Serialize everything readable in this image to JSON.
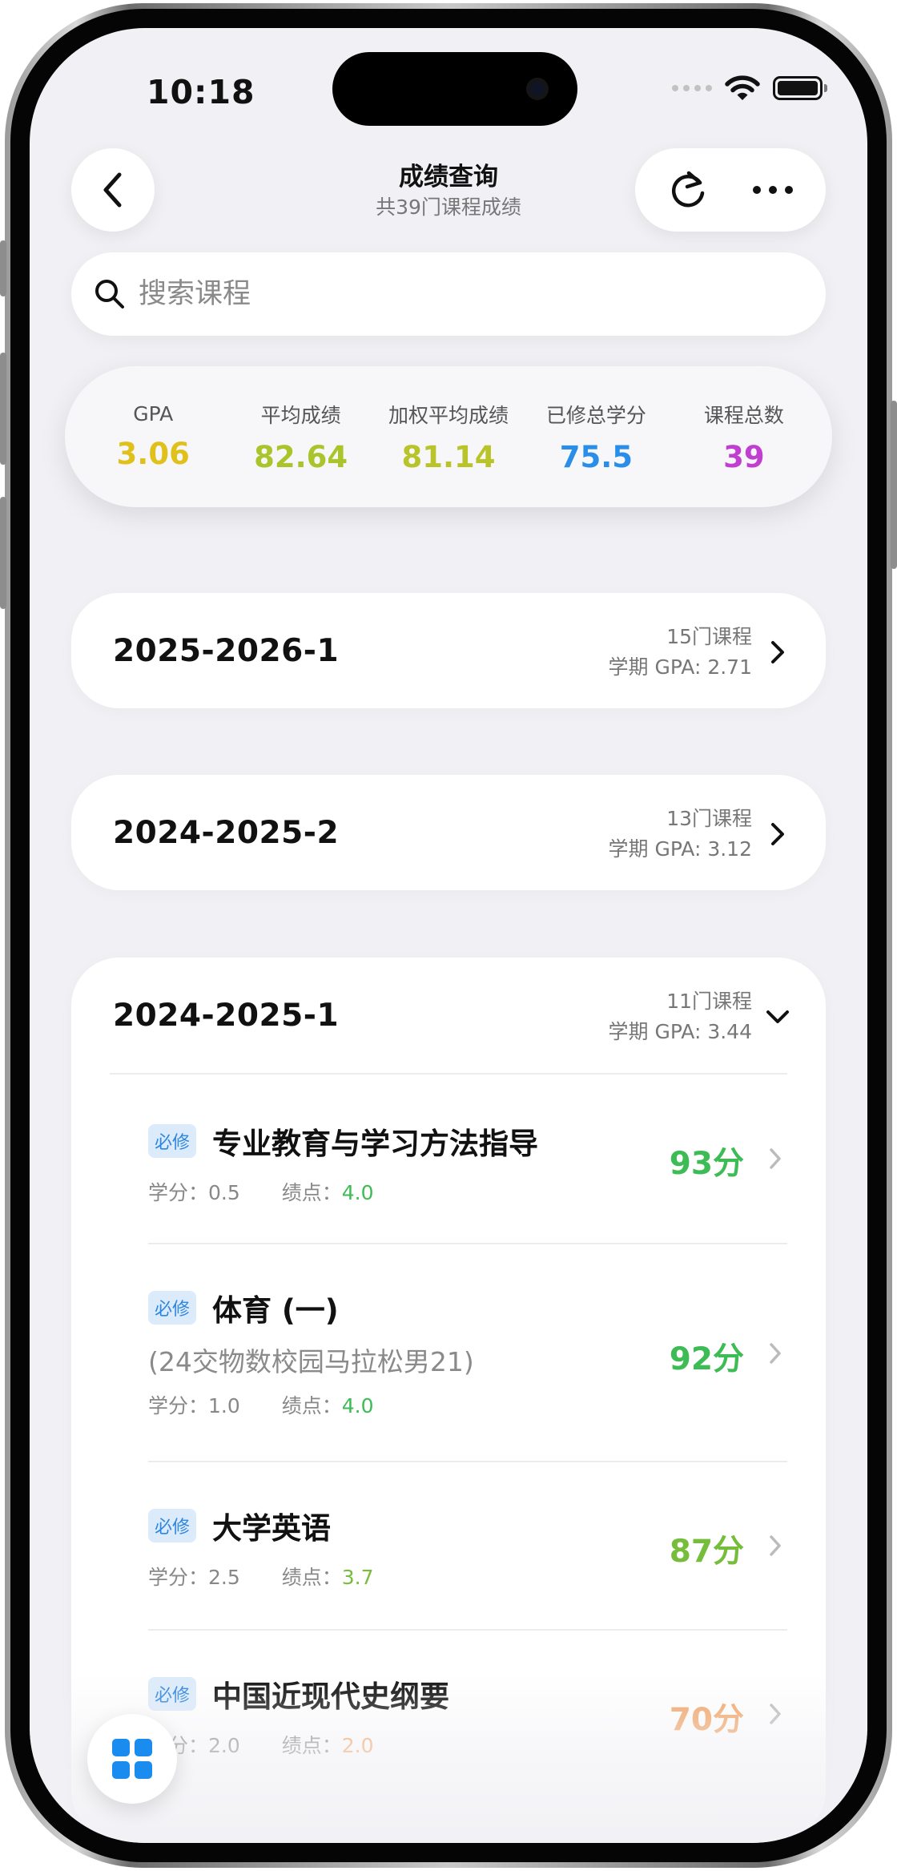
{
  "status_bar": {
    "time": "10:18"
  },
  "nav": {
    "title": "成绩查询",
    "subtitle": "共39门课程成绩",
    "back_icon": "chevron-left-icon",
    "refresh_icon": "refresh-icon",
    "more_icon": "ellipsis-icon"
  },
  "search": {
    "placeholder": "搜索课程",
    "value": ""
  },
  "stats": [
    {
      "label": "GPA",
      "value": "3.06",
      "color": "#e0c11b"
    },
    {
      "label": "平均成绩",
      "value": "82.64",
      "color": "#a9c52b"
    },
    {
      "label": "加权平均成绩",
      "value": "81.14",
      "color": "#b9c42a"
    },
    {
      "label": "已修总学分",
      "value": "75.5",
      "color": "#2a8ee8"
    },
    {
      "label": "课程总数",
      "value": "39",
      "color": "#c13fd0"
    }
  ],
  "semesters": [
    {
      "name": "2025-2026-1",
      "count": "15门课程",
      "gpa": "学期 GPA: 2.71",
      "expanded": false
    },
    {
      "name": "2024-2025-2",
      "count": "13门课程",
      "gpa": "学期 GPA: 3.12",
      "expanded": false
    },
    {
      "name": "2024-2025-1",
      "count": "11门课程",
      "gpa": "学期 GPA: 3.44",
      "expanded": true,
      "courses": [
        {
          "tag": "必修",
          "name": "专业教育与学习方法指导",
          "subtitle": "",
          "credit_label": "学分：",
          "credit": "0.5",
          "gp_label": "绩点：",
          "gp": "4.0",
          "gp_color": "#3dbb54",
          "score": "93分",
          "score_color": "#3dbb54"
        },
        {
          "tag": "必修",
          "name": "体育 (一)",
          "subtitle": "(24交物数校园马拉松男21)",
          "credit_label": "学分：",
          "credit": "1.0",
          "gp_label": "绩点：",
          "gp": "4.0",
          "gp_color": "#3dbb54",
          "score": "92分",
          "score_color": "#3dbb54"
        },
        {
          "tag": "必修",
          "name": "大学英语",
          "subtitle": "",
          "credit_label": "学分：",
          "credit": "2.5",
          "gp_label": "绩点：",
          "gp": "3.7",
          "gp_color": "#77bd3c",
          "score": "87分",
          "score_color": "#77bd3c"
        },
        {
          "tag": "必修",
          "name": "中国近现代史纲要",
          "subtitle": "",
          "credit_label": "学分：",
          "credit": "2.0",
          "gp_label": "绩点：",
          "gp": "2.0",
          "gp_color": "#f2a465",
          "score": "70分",
          "score_color": "#f2a465"
        }
      ]
    }
  ],
  "fab": {
    "icon": "grid-icon"
  }
}
